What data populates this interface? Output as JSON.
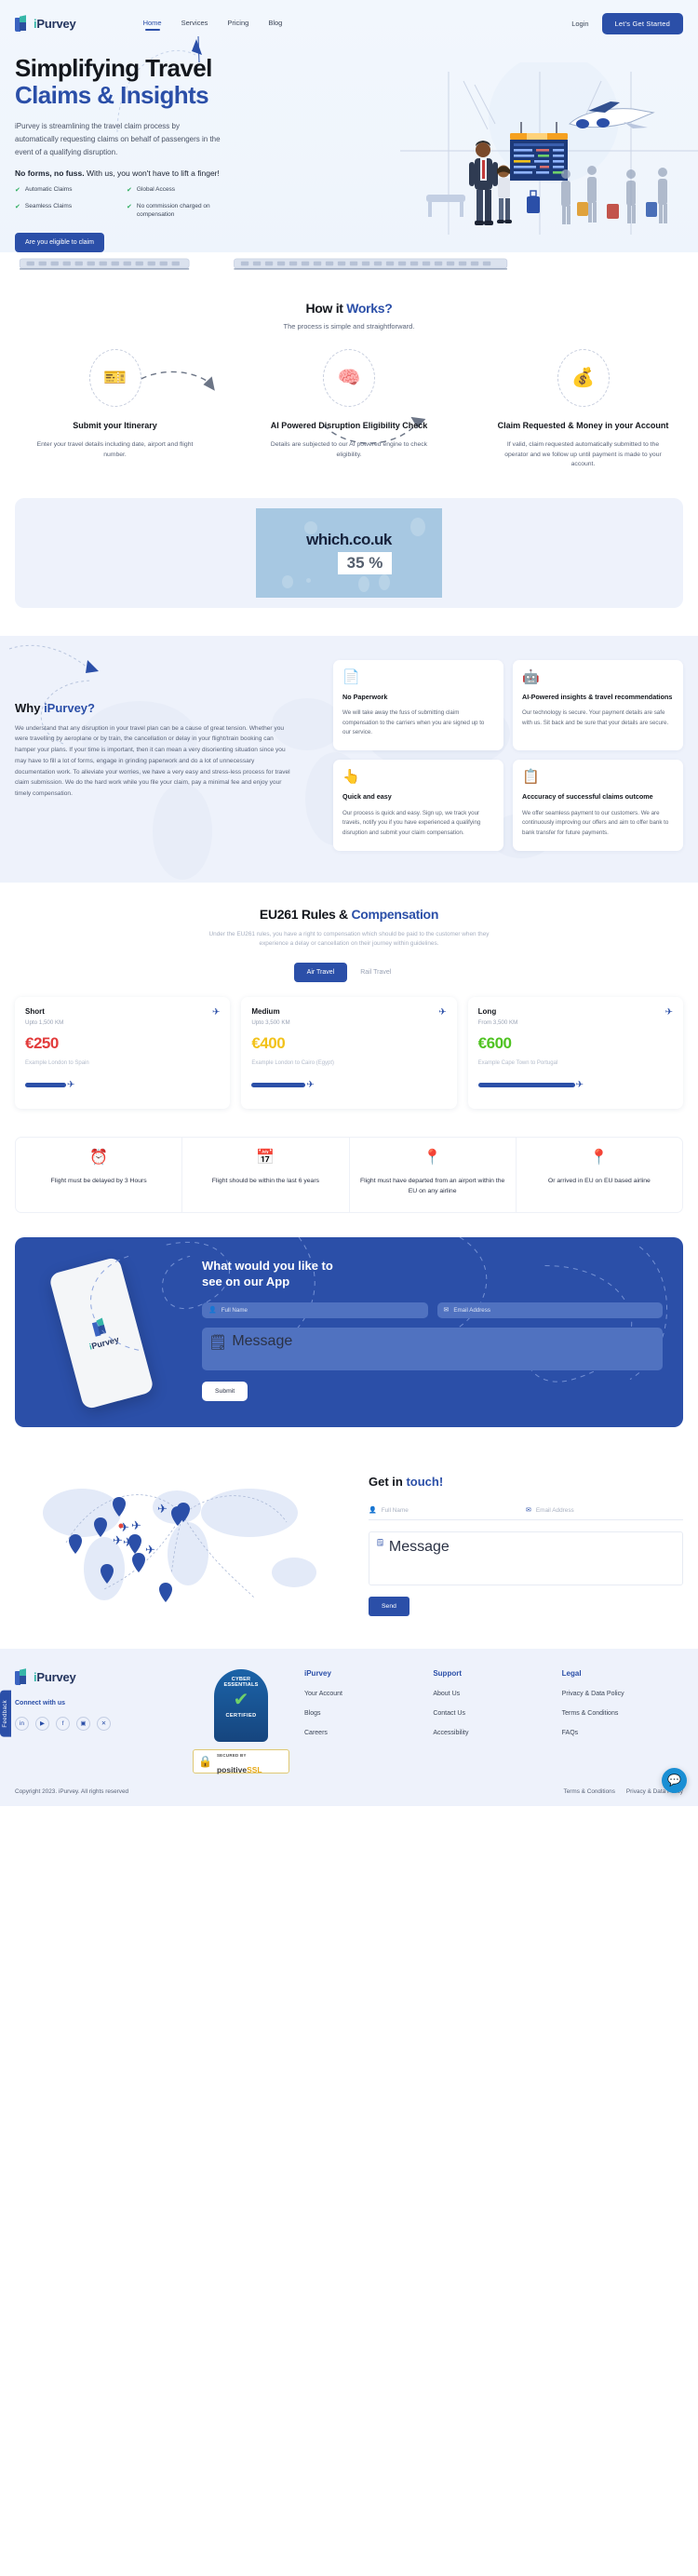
{
  "brand": {
    "name_i": "i",
    "name_rest": "Purvey"
  },
  "nav": {
    "links": [
      {
        "label": "Home",
        "active": true
      },
      {
        "label": "Services",
        "active": false
      },
      {
        "label": "Pricing",
        "active": false
      },
      {
        "label": "Blog",
        "active": false
      }
    ],
    "login": "Login",
    "cta": "Let's Get Started"
  },
  "hero": {
    "title_line1": "Simplifying Travel",
    "title_line2": "Claims & Insights",
    "paragraph": "iPurvey is streamlining the travel claim process by automatically requesting claims on behalf of passengers in the event of a qualifying disruption.",
    "bold_lead": "No forms, no fuss.",
    "bold_rest": " With us, you won't have to lift a finger!",
    "features": [
      "Automatic Claims",
      "Global Access",
      "Seamless Claims",
      "No commission charged on compensation"
    ],
    "button": "Are you eligible to claim"
  },
  "how": {
    "title_a": "How it ",
    "title_b": "Works?",
    "subtitle": "The process is simple and straightforward.",
    "steps": [
      {
        "icon": "🎫",
        "title": "Submit your Itinerary",
        "desc": "Enter your travel details including date, airport and flight number."
      },
      {
        "icon": "🧠",
        "title": "AI Powered Disruption Eligibility Check",
        "desc": "Details are subjected to our AI powered engine to check eligibility."
      },
      {
        "icon": "💰",
        "title": "Claim Requested & Money in your Account",
        "desc": "If valid, claim requested automatically submitted to the operator and we follow up until payment is made to your account."
      }
    ]
  },
  "banner": {
    "title": "which.co.uk",
    "percent": "35 %"
  },
  "why": {
    "title_a": "Why ",
    "title_b": "iPurvey?",
    "paragraph": "We understand that any disruption in your travel plan can be a cause of great tension. Whether you were travelling by aeroplane or by train, the cancellation or delay in your flight/train booking can hamper your plans. If your time is important, then it can mean a very disorienting situation since you may have to fill a lot of forms, engage in grinding paperwork and do a lot of unnecessary documentation work. To alleviate your worries, we have a very easy and stress-less process for travel claim submission. We do the hard work while you file your claim, pay a minimal fee and enjoy your timely compensation.",
    "cards": [
      {
        "icon": "📄",
        "title": "No Paperwork",
        "desc": "We will take away the fuss of submitting claim compensation to the carriers when you are signed up to our service."
      },
      {
        "icon": "🤖",
        "title": "AI-Powered insights & travel recommendations",
        "desc": "Our technology is secure. Your payment details are safe with us. Sit back and be sure that your details are secure."
      },
      {
        "icon": "👆",
        "title": "Quick and easy",
        "desc": "Our process is quick and easy. Sign up, we track your travels, notify you if you have experienced a qualifying disruption and submit your claim compensation."
      },
      {
        "icon": "📋",
        "title": "Acccuracy of successful claims outcome",
        "desc": "We offer seamless payment to our customers. We are continuously improving our offers and aim to offer bank to bank transfer for future payments."
      }
    ]
  },
  "eu": {
    "title_a": "EU261 Rules & ",
    "title_b": "Compensation",
    "subtitle": "Under the EU261 rules, you have a right to compensation which should be paid to the customer when they experience a delay or cancellation on their journey within guidelines.",
    "toggle": [
      {
        "label": "Air Travel",
        "active": true
      },
      {
        "label": "Rail Travel",
        "active": false
      }
    ],
    "prices": [
      {
        "name": "Short",
        "distance": "Upto 1,500 KM",
        "amount": "€250",
        "color": "#e23b3b",
        "example": "Example London to Spain"
      },
      {
        "name": "Medium",
        "distance": "Upto 3,500 KM",
        "amount": "€400",
        "color": "#f2c21a",
        "example": "Example London to Cairo (Egypt)"
      },
      {
        "name": "Long",
        "distance": "From 3,500 KM",
        "amount": "€600",
        "color": "#4fc322",
        "example": "Example Cape Town to Portugal"
      }
    ],
    "conditions": [
      {
        "icon": "⏰",
        "text": "Flight must be delayed by 3 Hours"
      },
      {
        "icon": "📅",
        "text": "Flight should be within the last 6 years"
      },
      {
        "icon": "📍",
        "text": "Flight must have departed from an airport within the EU on any airline"
      },
      {
        "icon": "📍",
        "text": "Or arrived in EU on EU based airline"
      }
    ]
  },
  "appcta": {
    "heading_line1": "What would you like to",
    "heading_line2": "see on our App",
    "name_placeholder": "Full Name",
    "email_placeholder": "Email Address",
    "message_placeholder": "Message",
    "submit": "Submit",
    "phone_brand_i": "i",
    "phone_brand_rest": "Purvey"
  },
  "touch": {
    "title_a": "Get in ",
    "title_b": "touch!",
    "name_placeholder": "Full Name",
    "email_placeholder": "Email Address",
    "message_placeholder": "Message",
    "send": "Send"
  },
  "footer": {
    "connect": "Connect with us",
    "socials": [
      {
        "name": "linkedin-icon",
        "glyph": "in"
      },
      {
        "name": "youtube-icon",
        "glyph": "▶"
      },
      {
        "name": "facebook-icon",
        "glyph": "f"
      },
      {
        "name": "instagram-icon",
        "glyph": "▣"
      },
      {
        "name": "x-twitter-icon",
        "glyph": "✕"
      }
    ],
    "cyber_badge": {
      "line1": "CYBER",
      "line2": "ESSENTIALS",
      "line3": "CERTIFIED"
    },
    "ssl_badge": {
      "top": "SECURED BY",
      "main": "positive",
      "accent": "SSL"
    },
    "columns": [
      {
        "heading": "iPurvey",
        "links": [
          "Your Account",
          "Blogs",
          "Careers"
        ]
      },
      {
        "heading": "Support",
        "links": [
          "About Us",
          "Contact Us",
          "Accessibility"
        ]
      },
      {
        "heading": "Legal",
        "links": [
          "Privacy & Data Policy",
          "Terms & Conditions",
          "FAQs"
        ]
      }
    ],
    "copyright": "Copyright 2023. iPurvey. All rights reserved",
    "bottom_links": [
      "Terms & Conditions",
      "Privacy & Data Policy"
    ],
    "feedback": "Feedback"
  },
  "colors": {
    "primary": "#2b4fa8",
    "teal": "#35b6a8",
    "bg_light": "#eef2fb"
  }
}
